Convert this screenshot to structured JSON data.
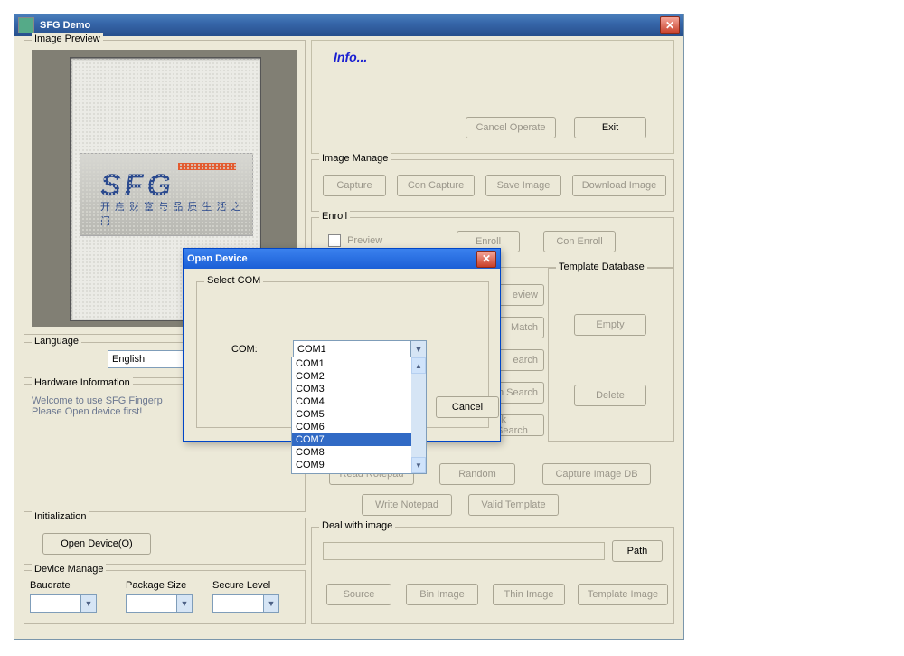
{
  "window": {
    "title": "SFG Demo"
  },
  "imagePreview": {
    "label": "Image Preview",
    "logo_text": "SFG",
    "logo_sub": "开 启 财 富 与 品 质 生 活 之 门"
  },
  "language": {
    "label": "Language",
    "value": "English"
  },
  "hardware": {
    "label": "Hardware Information",
    "line1": "Welcome to use SFG Fingerp",
    "line2": "Please Open device first!"
  },
  "initialization": {
    "label": "Initialization",
    "open_device": "Open Device(O)"
  },
  "deviceManage": {
    "label": "Device Manage",
    "baudrate": "Baudrate",
    "package": "Package Size",
    "secure": "Secure Level"
  },
  "info": {
    "title": "Info...",
    "cancel_operate": "Cancel Operate",
    "exit": "Exit"
  },
  "imageManage": {
    "label": "Image Manage",
    "capture": "Capture",
    "con_capture": "Con Capture",
    "save_image": "Save Image",
    "download_image": "Download Image"
  },
  "enroll": {
    "label": "Enroll",
    "preview_chk": "Preview",
    "enroll": "Enroll",
    "con_enroll": "Con Enroll"
  },
  "identify_right_partial": {
    "preview": "eview",
    "match": "Match",
    "search": "earch",
    "hsearch": "h Search",
    "cksearch": "ck Search",
    "read_notepad": "Read Notepad",
    "random": "Random",
    "capture_image_db": "Capture Image DB",
    "write_notepad": "Write Notepad",
    "valid_template": "Valid Template"
  },
  "templateDb": {
    "label": "Template Database",
    "empty": "Empty",
    "delete": "Delete"
  },
  "dealImage": {
    "label": "Deal with image",
    "path": "Path",
    "source": "Source",
    "binimage": "Bin Image",
    "thinimage": "Thin Image",
    "templateimage": "Template Image"
  },
  "dialog": {
    "title": "Open Device",
    "group": "Select COM",
    "com_label": "COM:",
    "selected": "COM1",
    "cancel": "Cancel",
    "options": [
      "COM1",
      "COM2",
      "COM3",
      "COM4",
      "COM5",
      "COM6",
      "COM7",
      "COM8",
      "COM9"
    ],
    "highlighted_index": 6
  }
}
